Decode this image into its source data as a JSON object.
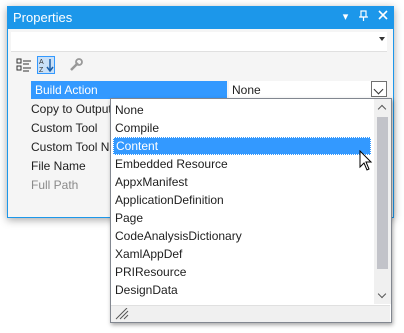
{
  "window": {
    "title": "Properties",
    "dropdown_icon": "chevron-down-icon",
    "pin_icon": "pin-icon",
    "close_icon": "close-icon"
  },
  "toolbar": {
    "categorized_icon": "categorized-icon",
    "alphabetical_icon": "sort-alphabetical-icon",
    "property_pages_icon": "wrench-icon"
  },
  "properties": [
    {
      "name": "Build Action",
      "value": "None"
    },
    {
      "name": "Copy to Output Directory",
      "value": ""
    },
    {
      "name": "Custom Tool",
      "value": ""
    },
    {
      "name": "Custom Tool Namespace",
      "value": ""
    },
    {
      "name": "File Name",
      "value": ""
    },
    {
      "name": "Full Path",
      "value": ""
    }
  ],
  "dropdown": {
    "selected": "Content",
    "options": [
      "None",
      "Compile",
      "Content",
      "Embedded Resource",
      "AppxManifest",
      "ApplicationDefinition",
      "Page",
      "CodeAnalysisDictionary",
      "XamlAppDef",
      "PRIResource",
      "DesignData"
    ]
  },
  "colors": {
    "accent": "#1c97ea",
    "selection": "#3399ff"
  }
}
